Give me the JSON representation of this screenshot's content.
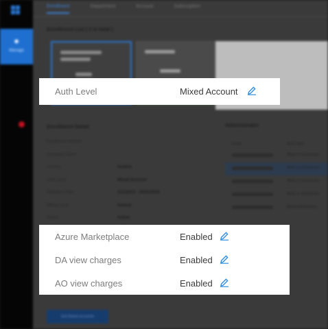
{
  "nav": {
    "manage_label": "Manage"
  },
  "tabs": [
    "Enrollment",
    "Department",
    "Account",
    "Subscription"
  ],
  "sections": {
    "enrollment_list": "Enrollment List ( 2 in total )",
    "enrollment_detail": "Enrollment Detail",
    "administrator": "Administrator"
  },
  "detail": {
    "rows": [
      {
        "k": "Enrollment Number",
        "v": ""
      },
      {
        "k": "Company Name",
        "v": ""
      },
      {
        "k": "Country",
        "v": "Austria"
      },
      {
        "k": "Auth Level",
        "v": "Mixed Account"
      },
      {
        "k": "Start/End Date",
        "v": "11/1/2013 - 10/31/2016"
      },
      {
        "k": "Billing Cycle",
        "v": "Annual"
      },
      {
        "k": "Status",
        "v": "Active"
      }
    ]
  },
  "administrator": {
    "col_email": "Email",
    "col_auth": "Auth Type",
    "rows": [
      {
        "auth": "Work or School Acc"
      },
      {
        "auth": "Work or School Acc"
      },
      {
        "auth": "Work or School Acc"
      },
      {
        "auth": "Work or School Acc"
      },
      {
        "auth": "Microsoft Account"
      }
    ]
  },
  "cta_label": "Get linked accounts",
  "highlight_auth": {
    "label": "Auth Level",
    "value": "Mixed Account"
  },
  "highlight_settings": [
    {
      "label": "Azure Marketplace",
      "value": "Enabled"
    },
    {
      "label": "DA view charges",
      "value": "Enabled"
    },
    {
      "label": "AO view charges",
      "value": "Enabled"
    }
  ],
  "colors": {
    "accent": "#2a78d6",
    "edit_icon": "#2f8ee0",
    "status_green": "#2f8f2f"
  },
  "icons": {
    "edit": "pencil-icon",
    "brand": "windows-logo-icon",
    "manage": "manage-icon",
    "alert": "alert-dot-icon"
  }
}
